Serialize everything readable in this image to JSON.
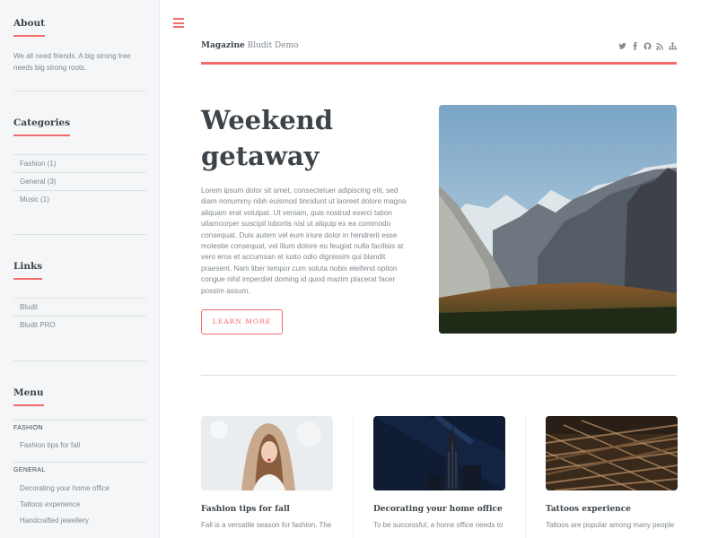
{
  "sidebar": {
    "about": {
      "title": "About",
      "text": "We all need friends. A big strong tree needs big strong roots."
    },
    "categories": {
      "title": "Categories",
      "items": [
        "Fashion (1)",
        "General (3)",
        "Music (1)"
      ]
    },
    "links": {
      "title": "Links",
      "items": [
        "Bludit",
        "Bludit PRO"
      ]
    },
    "menu": {
      "title": "Menu",
      "groups": [
        {
          "label": "FASHION",
          "items": [
            "Fashion tips for fall"
          ]
        },
        {
          "label": "GENERAL",
          "items": [
            "Decorating your home office",
            "Tattoos experience",
            "Handcrafted jewellery"
          ]
        }
      ]
    }
  },
  "header": {
    "logo_bold": "Magazine",
    "logo_light": "Bludit Demo",
    "social": [
      "twitter-icon",
      "facebook-icon",
      "github-icon",
      "rss-icon",
      "sitemap-icon"
    ]
  },
  "hero": {
    "title": "Weekend getaway",
    "text": "Lorem ipsum dolor sit amet, consectetuer adipiscing elit, sed diam nonummy nibh euismod tincidunt ut laoreet dolore magna aliquam erat volutpat. Ut veniam, quis nostrud exerci tation ullamcorper suscipit lobortis nisl ut aliquip ex ea commodo consequat. Duis autem vel eum iriure dolor in hendrerit esse molestie consequat, vel illum dolore eu feugiat nulla facilisis at vero eros et accumsan et iusto odio dignissim qui blandit praesent. Nam liber tempor cum soluta nobis eleifend option congue nihil imperdiet doming id quod mazim placerat facer possim assum.",
    "button": "LEARN MORE"
  },
  "posts": [
    {
      "title": "Fashion tips for fall",
      "excerpt": "Fall is a versatile season for fashion. The"
    },
    {
      "title": "Decorating your home office",
      "excerpt": "To be successful, a home office needs to"
    },
    {
      "title": "Tattoos experience",
      "excerpt": "Tattoos are popular among many people"
    }
  ],
  "colors": {
    "accent": "#f56a6a",
    "text": "#3d4449",
    "muted": "#7f888f",
    "sidebar_bg": "#f5f6f7"
  }
}
